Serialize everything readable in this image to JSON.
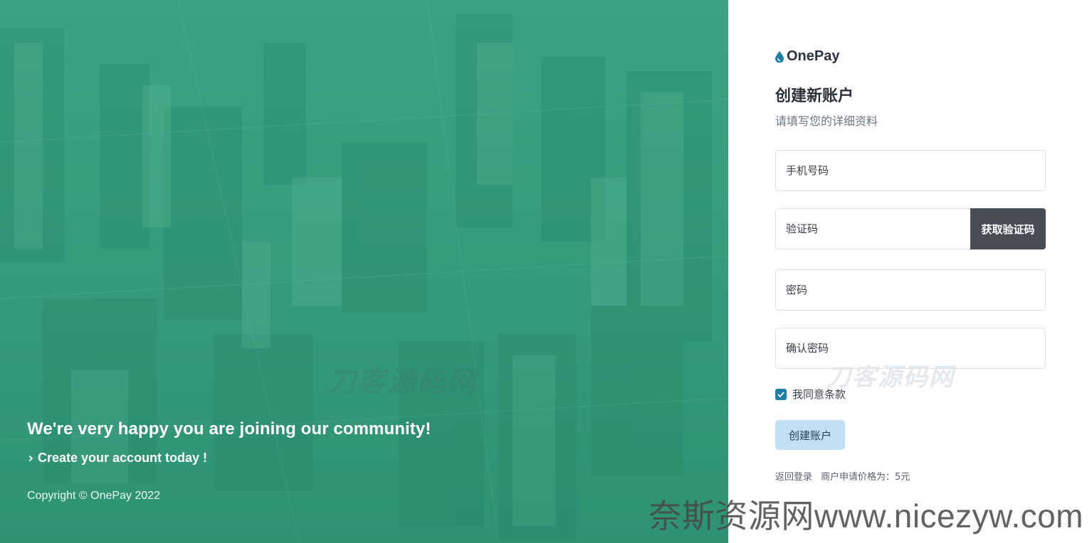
{
  "hero": {
    "headline": "We're very happy you are joining our community!",
    "subline": "Create your account today !",
    "copyright": "Copyright © OnePay 2022",
    "watermark": "刀客源码网"
  },
  "brand": {
    "name": "OnePay",
    "icon": "drop-icon",
    "accent_color": "#1f7fa8"
  },
  "form": {
    "title": "创建新账户",
    "subtitle": "请填写您的详细资料",
    "phone_placeholder": "手机号码",
    "code_placeholder": "验证码",
    "get_code_label": "获取验证码",
    "password_placeholder": "密码",
    "confirm_password_placeholder": "确认密码",
    "agree_label": "我同意条款",
    "agree_checked": true,
    "submit_label": "创建账户",
    "watermark": "刀客源码网"
  },
  "footer": {
    "back_to_login": "返回登录",
    "merchant_price": "商户申请价格为：5元"
  },
  "overlay": {
    "site_watermark": "奈斯资源网www.nicezyw.com"
  },
  "colors": {
    "hero_green": "#3ea486",
    "code_button_bg": "#484d55",
    "submit_button_bg": "#bfe1f3"
  }
}
